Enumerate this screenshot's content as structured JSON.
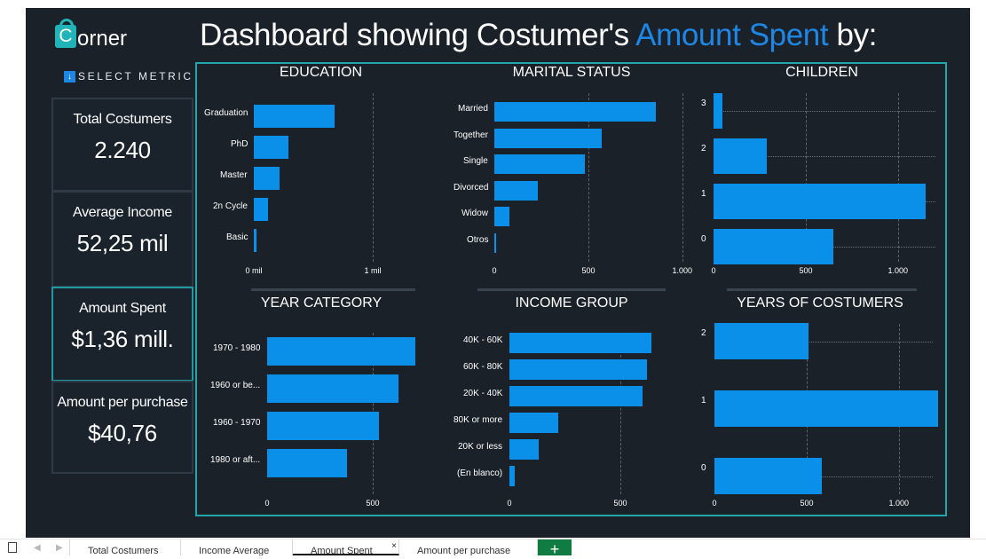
{
  "logo": {
    "initial": "C",
    "text": "orner"
  },
  "title": {
    "main": "Dashboard showing Costumer's ",
    "accent": "Amount Spent",
    "tail": " by:"
  },
  "select_metric": {
    "arrow": "↓",
    "label": "SELECT METRIC"
  },
  "kpis": [
    {
      "label": "Total Costumers",
      "value": "2.240"
    },
    {
      "label": "Average Income",
      "value": "52,25 mil"
    },
    {
      "label": "Amount Spent",
      "value": "$1,36 mill."
    },
    {
      "label": "Amount per purchase",
      "value": "$40,76"
    }
  ],
  "charts": {
    "education": {
      "title": "EDUCATION"
    },
    "marital": {
      "title": "MARITAL STATUS"
    },
    "children": {
      "title": "CHILDREN"
    },
    "year_category": {
      "title": "YEAR CATEGORY"
    },
    "income_group": {
      "title": "INCOME GROUP"
    },
    "years_costumers": {
      "title": "YEARS OF COSTUMERS"
    }
  },
  "chart_data": [
    {
      "type": "bar",
      "title": "EDUCATION",
      "categories": [
        "Graduation",
        "PhD",
        "Master",
        "2n Cycle",
        "Basic"
      ],
      "values": [
        680000,
        290000,
        220000,
        120000,
        20000
      ],
      "ticks": [
        "0 mil",
        "1 mil"
      ],
      "xlim": [
        0,
        1200000
      ]
    },
    {
      "type": "bar",
      "title": "MARITAL STATUS",
      "categories": [
        "Married",
        "Together",
        "Single",
        "Divorced",
        "Widow",
        "Otros"
      ],
      "values": [
        860,
        570,
        480,
        230,
        80,
        5
      ],
      "ticks": [
        "0",
        "500",
        "1.000"
      ],
      "xlim": [
        0,
        1000
      ]
    },
    {
      "type": "bar",
      "title": "CHILDREN",
      "categories": [
        "3",
        "2",
        "1",
        "0"
      ],
      "values": [
        50,
        290,
        1150,
        650
      ],
      "ticks": [
        "0",
        "500",
        "1.000"
      ],
      "xlim": [
        0,
        1200
      ]
    },
    {
      "type": "bar",
      "title": "YEAR CATEGORY",
      "categories": [
        "1970 - 1980",
        "1960 or be...",
        "1960 - 1970",
        "1980 or aft..."
      ],
      "values": [
        700,
        620,
        530,
        380
      ],
      "ticks": [
        "0",
        "500"
      ],
      "xlim": [
        0,
        750
      ]
    },
    {
      "type": "bar",
      "title": "INCOME GROUP",
      "categories": [
        "40K - 60K",
        "60K - 80K",
        "20K - 40K",
        "80K or more",
        "20K or less",
        "(En blanco)"
      ],
      "values": [
        640,
        620,
        600,
        220,
        130,
        25
      ],
      "ticks": [
        "0",
        "500"
      ],
      "xlim": [
        0,
        700
      ]
    },
    {
      "type": "bar",
      "title": "YEARS OF COSTUMERS",
      "categories": [
        "2",
        "1",
        "0"
      ],
      "values": [
        510,
        1210,
        580
      ],
      "ticks": [
        "0",
        "500",
        "1.000"
      ],
      "xlim": [
        0,
        1250
      ]
    }
  ],
  "tabs": {
    "items": [
      {
        "label": "Total Costumers"
      },
      {
        "label": "Income Average"
      },
      {
        "label": "Amount Spent"
      },
      {
        "label": "Amount per purchase"
      }
    ],
    "close": "×",
    "add": "+",
    "prev": "◀",
    "next": "▶"
  },
  "colors": {
    "background": "#1b2129",
    "bar": "#0a90e8",
    "accent": "#1e87e5",
    "frame": "#21a6ab",
    "logo": "#20b3b8"
  }
}
